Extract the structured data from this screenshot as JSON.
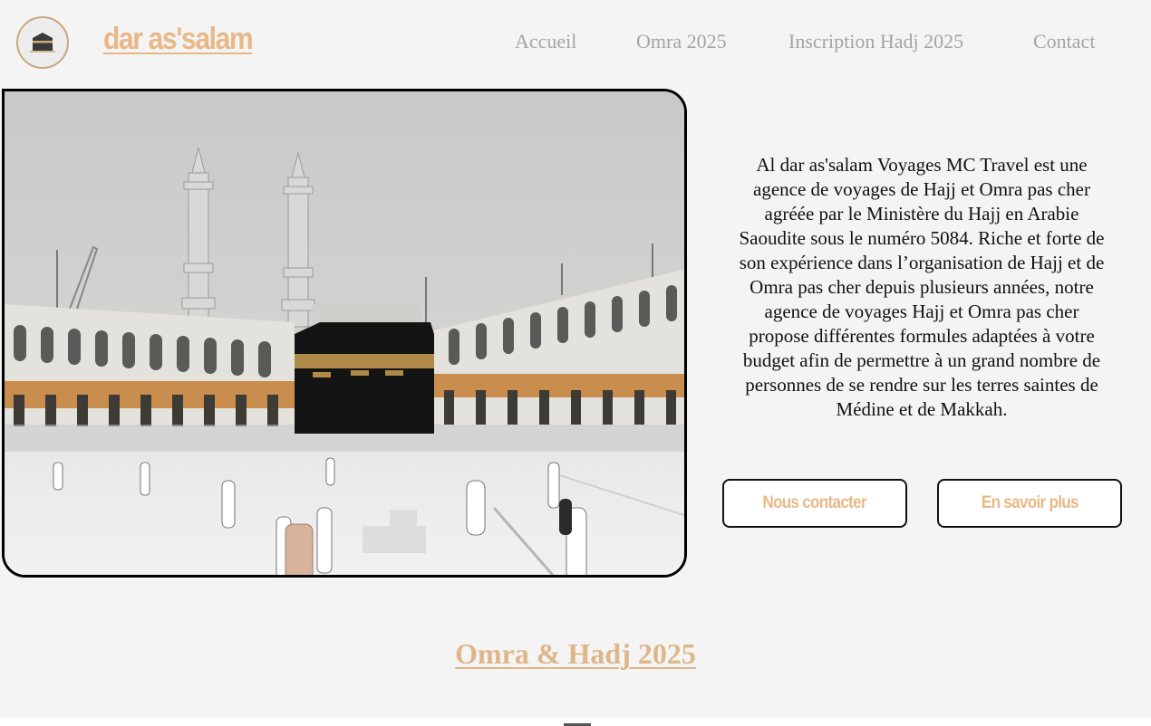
{
  "brand": {
    "name": "dar as'salam",
    "logo_icon": "kaaba-icon"
  },
  "nav": {
    "items": [
      {
        "label": "Accueil"
      },
      {
        "label": "Omra 2025"
      },
      {
        "label": "Inscription Hadj 2025"
      },
      {
        "label": "Contact"
      }
    ]
  },
  "hero": {
    "image_name": "kaaba-mecca-photo",
    "intro_text": "Al dar as'salam Voyages MC Travel est une agence de voyages de Hajj et Omra pas cher agréée par le Ministère du Hajj en Arabie Saoudite sous le numéro 5084. Riche et forte de son expérience dans l’organisation de Hajj et de Omra pas cher depuis plusieurs années, notre agence de voyages Hajj et Omra pas cher propose différentes formules adaptées à votre budget afin de permettre à un grand nombre de personnes de se rendre sur les terres saintes de Médine et de Makkah.",
    "buttons": {
      "contact": "Nous contacter",
      "more": "En savoir plus"
    }
  },
  "section": {
    "title": "Omra & Hadj 2025"
  },
  "colors": {
    "accent": "#e8b887",
    "nav_text": "#a4a4a4",
    "background": "#f4f4f4"
  }
}
